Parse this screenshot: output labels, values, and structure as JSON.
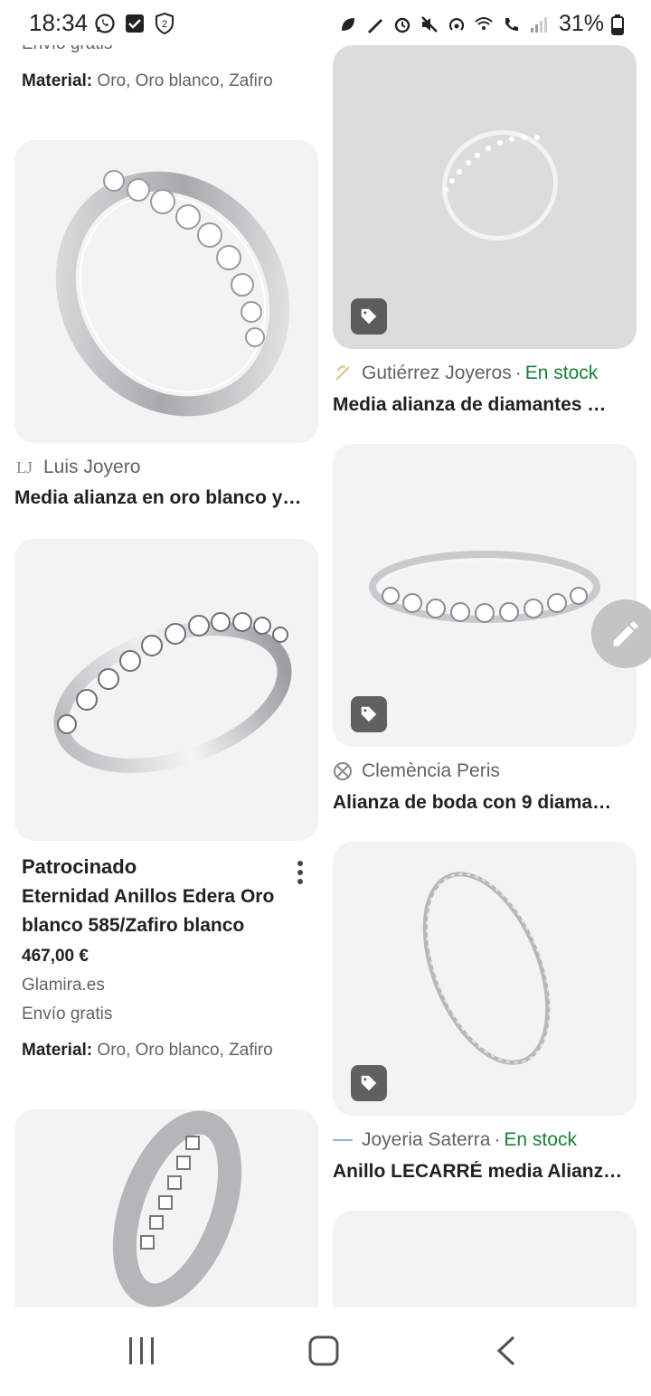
{
  "status_bar": {
    "time": "18:34",
    "battery": "31%"
  },
  "left_column": {
    "top_partial": {
      "shipping": "Envío gratis",
      "material_label": "Material:",
      "material_value": " Oro, Oro blanco, Zafiro"
    },
    "card1": {
      "merchant": "Luis Joyero",
      "merchant_logo": "LJ",
      "title": "Media alianza en oro blanco y…"
    },
    "card2": {
      "sponsored_label": "Patrocinado",
      "title_line1": "Eternidad Anillos Edera Oro",
      "title_line2": "blanco 585/Zafiro blanco",
      "price": "467,00 €",
      "store": "Glamira.es",
      "shipping": "Envío gratis",
      "material_label": "Material:",
      "material_value": " Oro, Oro blanco, Zafiro"
    }
  },
  "right_column": {
    "card1": {
      "merchant": "Gutiérrez Joyeros",
      "stock": "En stock",
      "title": "Media alianza de diamantes …"
    },
    "card2": {
      "merchant": "Clemència Peris",
      "title": "Alianza de boda con 9 diama…"
    },
    "card3": {
      "merchant": "Joyeria Saterra",
      "stock": "En stock",
      "title": "Anillo LECARRÉ media Alianz…"
    }
  },
  "separator": "·",
  "icons": {
    "whatsapp": "whatsapp-icon",
    "check": "checkbox-icon",
    "shield": "shield-2-icon",
    "edit": "pencil-edit-icon",
    "tag": "price-tag-icon",
    "more": "more-vertical-icon",
    "nav_recent": "recent-apps-icon",
    "nav_home": "home-icon",
    "nav_back": "back-icon"
  },
  "colors": {
    "stock_green": "#188038",
    "card_bg": "#f3f3f4",
    "text": "#202124",
    "muted": "#5f6368"
  }
}
